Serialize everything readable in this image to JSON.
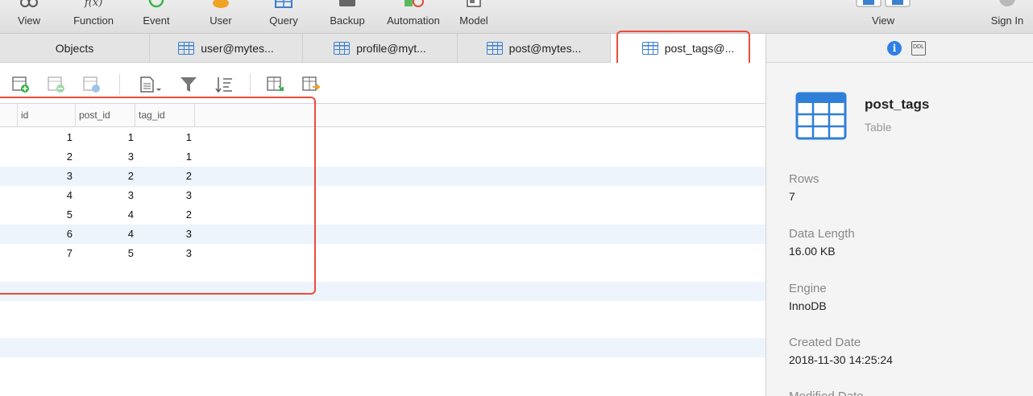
{
  "toolbar": {
    "buttons": [
      {
        "label": "View",
        "icon": "view-icon"
      },
      {
        "label": "Function",
        "icon": "function-icon"
      },
      {
        "label": "Event",
        "icon": "event-icon"
      },
      {
        "label": "User",
        "icon": "user-icon"
      },
      {
        "label": "Query",
        "icon": "query-icon"
      },
      {
        "label": "Backup",
        "icon": "backup-icon"
      },
      {
        "label": "Automation",
        "icon": "automation-icon"
      },
      {
        "label": "Model",
        "icon": "model-icon"
      },
      {
        "label": "View",
        "icon": "view-toggle-icon"
      },
      {
        "label": "Sign In",
        "icon": "avatar-icon"
      }
    ]
  },
  "tabs": [
    {
      "label": "Objects"
    },
    {
      "label": "user@mytes..."
    },
    {
      "label": "profile@myt..."
    },
    {
      "label": "post@mytes..."
    },
    {
      "label": "post_tags@..."
    }
  ],
  "grid": {
    "columns": [
      "id",
      "post_id",
      "tag_id"
    ],
    "rows": [
      [
        "1",
        "1",
        "1"
      ],
      [
        "2",
        "3",
        "1"
      ],
      [
        "3",
        "2",
        "2"
      ],
      [
        "4",
        "3",
        "3"
      ],
      [
        "5",
        "4",
        "2"
      ],
      [
        "6",
        "4",
        "3"
      ],
      [
        "7",
        "5",
        "3"
      ]
    ]
  },
  "info_panel": {
    "name": "post_tags",
    "type": "Table",
    "fields": [
      {
        "label": "Rows",
        "value": "7"
      },
      {
        "label": "Data Length",
        "value": "16.00 KB"
      },
      {
        "label": "Engine",
        "value": "InnoDB"
      },
      {
        "label": "Created Date",
        "value": "2018-11-30 14:25:24"
      },
      {
        "label": "Modified Date",
        "value": ""
      }
    ]
  },
  "colors": {
    "accent": "#3b7fd0",
    "highlight": "#ee4b3a",
    "stripe": "#eef4fc"
  }
}
